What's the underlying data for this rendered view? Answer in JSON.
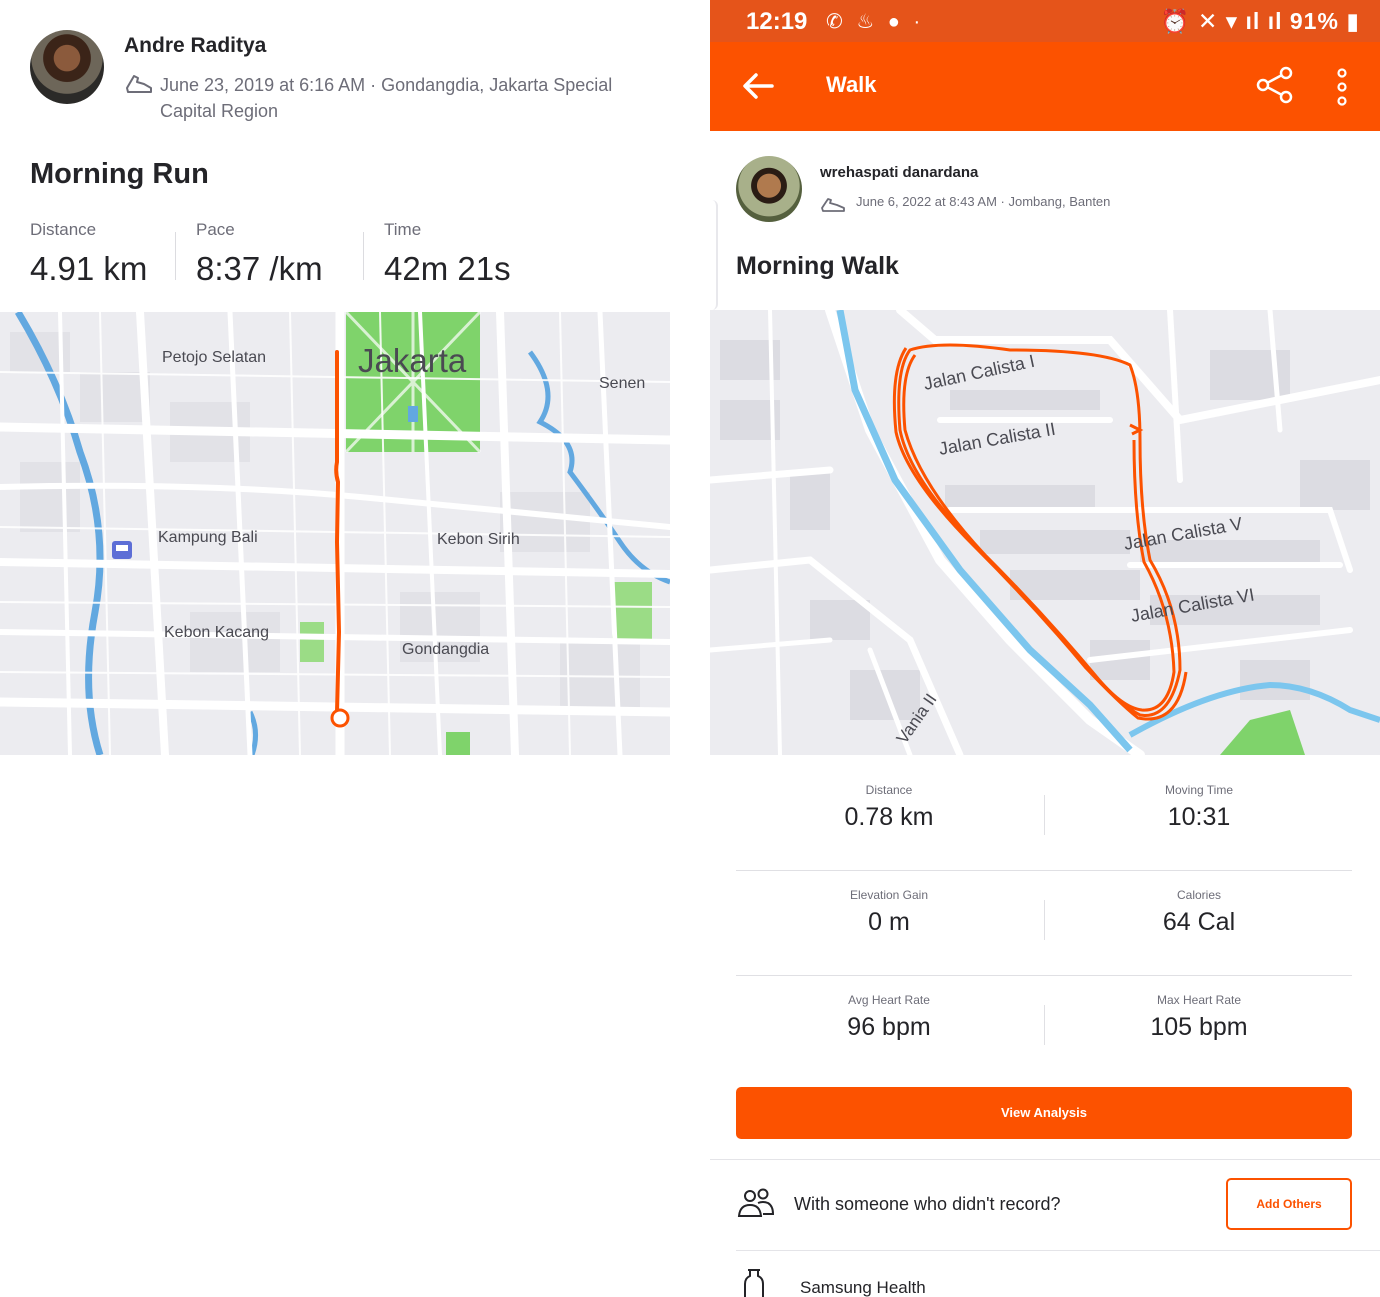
{
  "left": {
    "athlete_name": "Andre Raditya",
    "meta": "June 23, 2019 at 6:16 AM · Gondangdia, Jakarta Special Capital Region",
    "activity_title": "Morning Run",
    "stats": [
      {
        "label": "Distance",
        "value": "4.91 km"
      },
      {
        "label": "Pace",
        "value": "8:37 /km"
      },
      {
        "label": "Time",
        "value": "42m 21s"
      }
    ],
    "map": {
      "labels": {
        "city": "Jakarta",
        "petojo": "Petojo Selatan",
        "senen": "Senen",
        "kampung_bali": "Kampung Bali",
        "kebon_sirih": "Kebon Sirih",
        "kebon_kacang": "Kebon Kacang",
        "gondangdia": "Gondangdia"
      },
      "route_color": "#fc5200"
    }
  },
  "right": {
    "status_bar": {
      "time": "12:19",
      "battery": "91%"
    },
    "app_bar": {
      "title": "Walk"
    },
    "athlete_name": "wrehaspati danardana",
    "meta": "June 6, 2022 at 8:43 AM · Jombang, Banten",
    "activity_title": "Morning Walk",
    "map": {
      "labels": {
        "calista_1": "Jalan Calista I",
        "calista_2": "Jalan Calista II",
        "calista_5": "Jalan Calista V",
        "calista_6": "Jalan Calista VI",
        "vania": "Vania II"
      }
    },
    "stats": [
      {
        "label": "Distance",
        "value": "0.78 km"
      },
      {
        "label": "Moving Time",
        "value": "10:31"
      },
      {
        "label": "Elevation Gain",
        "value": "0 m"
      },
      {
        "label": "Calories",
        "value": "64 Cal"
      },
      {
        "label": "Avg Heart Rate",
        "value": "96 bpm"
      },
      {
        "label": "Max Heart Rate",
        "value": "105 bpm"
      }
    ],
    "view_analysis": "View Analysis",
    "with_someone": "With someone who didn't record?",
    "add_others": "Add Others",
    "samsung": "Samsung Health"
  },
  "colors": {
    "brand": "#fc5200",
    "status_bar": "#e5541a",
    "text": "#242428",
    "muted": "#6d6d78",
    "map_bg": "#ececf0",
    "park": "#7fd36b",
    "water": "#62a8e0"
  }
}
